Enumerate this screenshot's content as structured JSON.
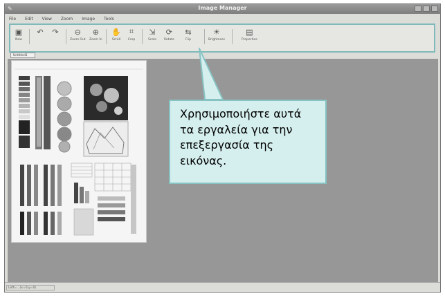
{
  "window": {
    "title": "Image Manager"
  },
  "menu": [
    "File",
    "Edit",
    "View",
    "Zoom",
    "Image",
    "Tools"
  ],
  "toolbar": {
    "new": "New",
    "zoom_out": "Zoom Out",
    "zoom_in": "Zoom In",
    "scroll": "Scroll",
    "crop": "Crop",
    "scale": "Scale",
    "rotate": "Rotate",
    "flip": "Flip",
    "brightness": "Brightness",
    "properties": "Properties"
  },
  "tab": {
    "label": "Untitled1"
  },
  "status": {
    "text": "Left=...(x=0,y=0)"
  },
  "callout": {
    "lines": [
      "Χρησιμοποιήστε αυτά",
      "τα εργαλεία για την",
      "επεξεργασία της",
      "εικόνας."
    ]
  },
  "colors": {
    "callout_fill": "#d5eeee",
    "callout_border": "#88c3c3",
    "canvas": "#979797",
    "toolbar_highlight": "#7fb9b9"
  }
}
